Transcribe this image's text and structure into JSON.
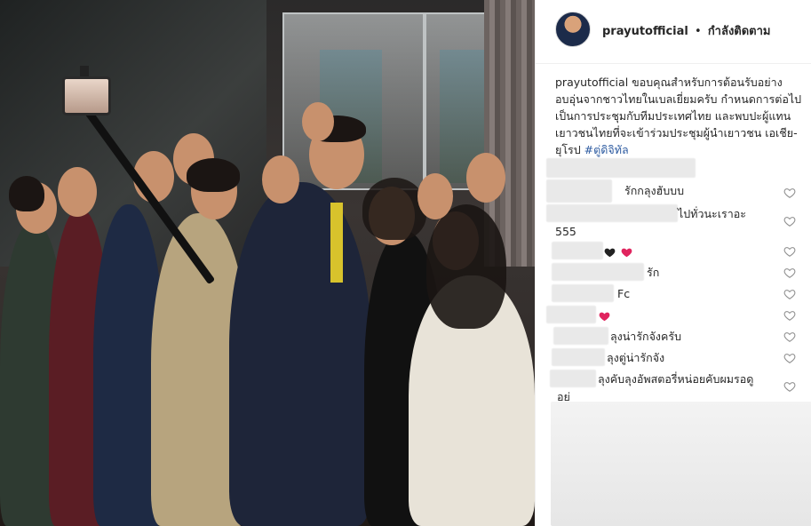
{
  "post": {
    "username": "prayutofficial",
    "separator": "•",
    "follow_status": "กำลังติดตาม",
    "caption_user": "prayutofficial",
    "caption_text": " ขอบคุณสำหรับการต้อนรับอย่างอบอุ่นจากชาวไทยในเบลเยี่ยมครับ กำหนดการต่อไปเป็นการประชุมกับทีมประเทศไทย และพบปะผู้แทนเยาวชนไทยที่จะเข้าร่วมประชุมผู้นำเยาวชน เอเชีย-ยุโรป ",
    "caption_hashtag": "#ตู่ดิจิทัล"
  },
  "comments": [
    {
      "text": "",
      "has_like": false
    },
    {
      "text": "รักกลุงฮับบบ",
      "has_like": true
    },
    {
      "text": "ไปทั่วนะเราอะ",
      "has_like": true
    },
    {
      "text": "555",
      "has_like": false
    },
    {
      "text": "",
      "emoji": "black-heart-red-heart",
      "has_like": true
    },
    {
      "text": "รัก",
      "has_like": true
    },
    {
      "text": "Fc",
      "has_like": true
    },
    {
      "text": "",
      "emoji": "red-heart",
      "has_like": true
    },
    {
      "text": "ลุงน่ารักจังครับ",
      "has_like": true
    },
    {
      "text": "ลุงตู่น่ารักจัง",
      "has_like": true
    },
    {
      "text": "ลุงคับลุงอัพสตอรี่หน่อยคับผมรอดู",
      "has_like": true
    },
    {
      "text": "อย่",
      "has_like": false
    }
  ],
  "icons": {
    "like": "heart-outline-icon",
    "black_heart": "black-heart-icon",
    "red_heart": "red-heart-icon"
  },
  "colors": {
    "hashtag": "#2c5aa0",
    "text": "#262626",
    "like_icon": "#8e8e8e",
    "red_heart": "#e0245e"
  }
}
